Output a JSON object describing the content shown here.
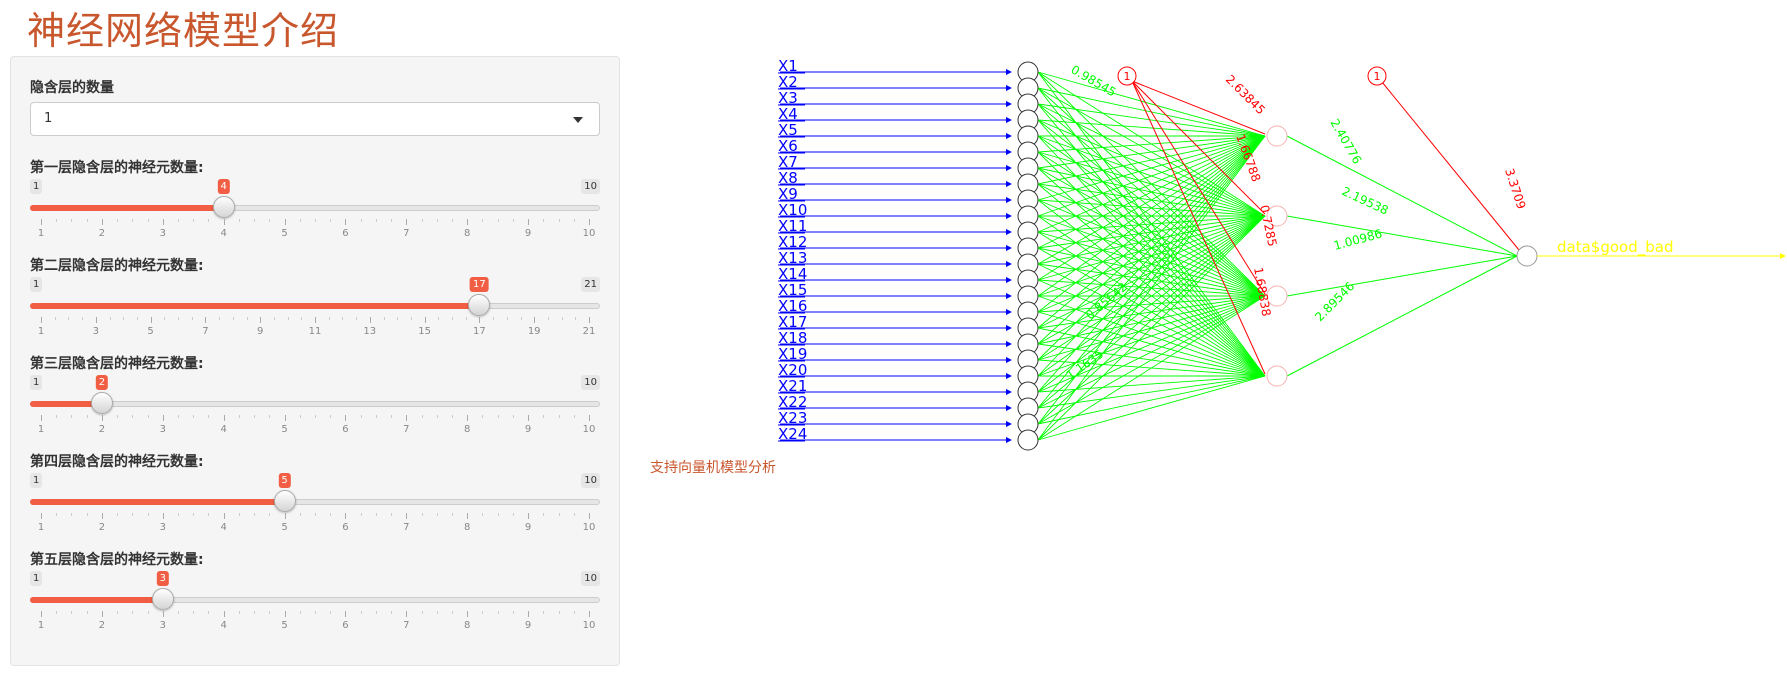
{
  "page_title": "神经网络模型介绍",
  "sidebar": {
    "hidden_layers_label": "隐含层的数量",
    "hidden_layers_value": "1",
    "sliders": [
      {
        "label": "第一层隐含层的神经元数量:",
        "min": 1,
        "max": 10,
        "value": 4,
        "min_text": "1",
        "max_text": "10",
        "value_text": "4",
        "grid": [
          "1",
          "2",
          "3",
          "4",
          "5",
          "6",
          "7",
          "8",
          "9",
          "10"
        ]
      },
      {
        "label": "第二层隐含层的神经元数量:",
        "min": 1,
        "max": 21,
        "value": 17,
        "min_text": "1",
        "max_text": "21",
        "value_text": "17",
        "grid": [
          "1",
          "3",
          "5",
          "7",
          "9",
          "11",
          "13",
          "15",
          "17",
          "19",
          "21"
        ]
      },
      {
        "label": "第三层隐含层的神经元数量:",
        "min": 1,
        "max": 10,
        "value": 2,
        "min_text": "1",
        "max_text": "10",
        "value_text": "2",
        "grid": [
          "1",
          "2",
          "3",
          "4",
          "5",
          "6",
          "7",
          "8",
          "9",
          "10"
        ]
      },
      {
        "label": "第四层隐含层的神经元数量:",
        "min": 1,
        "max": 10,
        "value": 5,
        "min_text": "1",
        "max_text": "10",
        "value_text": "5",
        "grid": [
          "1",
          "2",
          "3",
          "4",
          "5",
          "6",
          "7",
          "8",
          "9",
          "10"
        ]
      },
      {
        "label": "第五层隐含层的神经元数量:",
        "min": 1,
        "max": 10,
        "value": 3,
        "min_text": "1",
        "max_text": "10",
        "value_text": "3",
        "grid": [
          "1",
          "2",
          "3",
          "4",
          "5",
          "6",
          "7",
          "8",
          "9",
          "10"
        ]
      }
    ]
  },
  "network": {
    "inputs": [
      "X1",
      "X2",
      "X3",
      "X4",
      "X5",
      "X6",
      "X7",
      "X8",
      "X9",
      "X10",
      "X11",
      "X12",
      "X13",
      "X14",
      "X15",
      "X16",
      "X17",
      "X18",
      "X19",
      "X20",
      "X21",
      "X22",
      "X23",
      "X24"
    ],
    "hidden_count": 4,
    "bias_label": "1",
    "hidden_bias_weights": [
      "2.63845",
      "1.66788",
      "0.7285",
      "1.68838"
    ],
    "output_weights": [
      "2.40776",
      "2.19538",
      "1.00986",
      "2.89546"
    ],
    "output_bias_weight": "3.3709",
    "first_layer_weight_labels": [
      "0.98545",
      "0.85642",
      "1.1635"
    ],
    "output_label": "data$good_bad",
    "colors": {
      "input": "#0000ff",
      "weight": "#00ff00",
      "bias": "#ff0000",
      "output": "#ffff00",
      "node": "#333333"
    }
  },
  "note": "支持向量机模型分析"
}
